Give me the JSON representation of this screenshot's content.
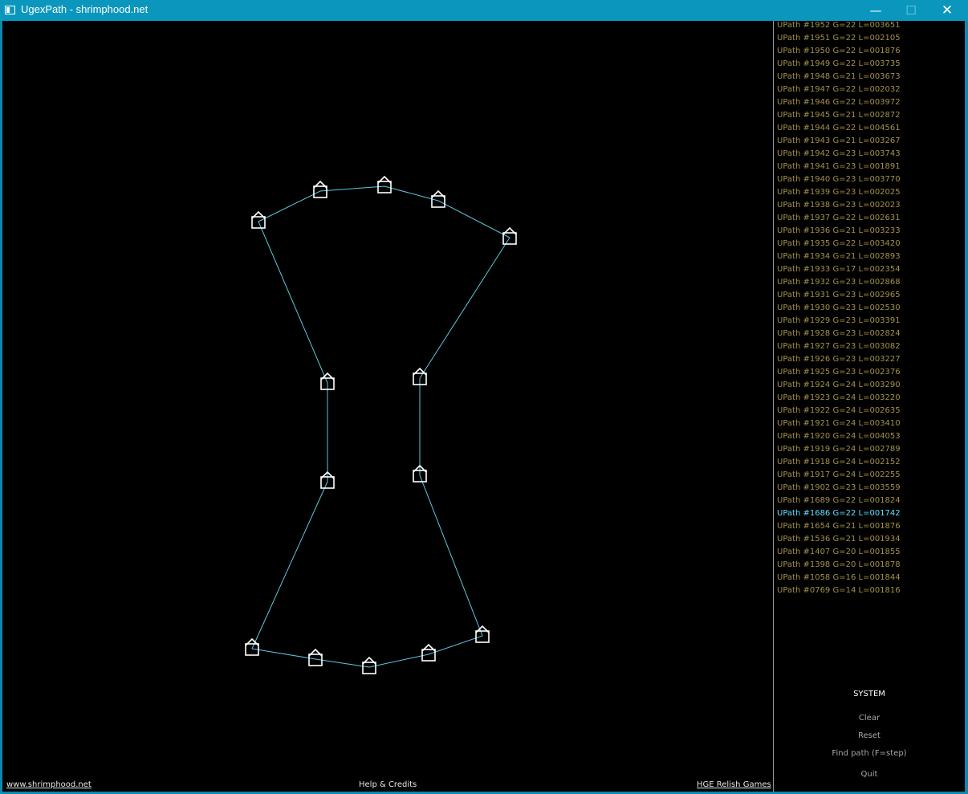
{
  "window": {
    "title": "UgexPath - shrimphood.net",
    "minimize": "—",
    "maximize": "☐",
    "close": "✕"
  },
  "path_list": [
    "UPath #1952 G=22 L=003651",
    "UPath #1951 G=22 L=002105",
    "UPath #1950 G=22 L=001876",
    "UPath #1949 G=22 L=003735",
    "UPath #1948 G=21 L=003673",
    "UPath #1947 G=22 L=002032",
    "UPath #1946 G=22 L=003972",
    "UPath #1945 G=21 L=002872",
    "UPath #1944 G=22 L=004561",
    "UPath #1943 G=21 L=003267",
    "UPath #1942 G=23 L=003743",
    "UPath #1941 G=23 L=001891",
    "UPath #1940 G=23 L=003770",
    "UPath #1939 G=23 L=002025",
    "UPath #1938 G=23 L=002023",
    "UPath #1937 G=22 L=002631",
    "UPath #1936 G=21 L=003233",
    "UPath #1935 G=22 L=003420",
    "UPath #1934 G=21 L=002893",
    "UPath #1933 G=17 L=002354",
    "UPath #1932 G=23 L=002868",
    "UPath #1931 G=23 L=002965",
    "UPath #1930 G=23 L=002530",
    "UPath #1929 G=23 L=003391",
    "UPath #1928 G=23 L=002824",
    "UPath #1927 G=23 L=003082",
    "UPath #1926 G=23 L=003227",
    "UPath #1925 G=23 L=002376",
    "UPath #1924 G=24 L=003290",
    "UPath #1923 G=24 L=003220",
    "UPath #1922 G=24 L=002635",
    "UPath #1921 G=24 L=003410",
    "UPath #1920 G=24 L=004053",
    "UPath #1919 G=24 L=002789",
    "UPath #1918 G=24 L=002152",
    "UPath #1917 G=24 L=002255",
    "UPath #1902 G=23 L=003559",
    "UPath #1689 G=22 L=001824",
    "UPath #1686 G=22 L=001742",
    "UPath #1654 G=21 L=001876",
    "UPath #1536 G=21 L=001934",
    "UPath #1407 G=20 L=001855",
    "UPath #1398 G=20 L=001878",
    "UPath #1058 G=16 L=001844",
    "UPath #0769 G=14 L=001816"
  ],
  "selected_path_index": 38,
  "menu": {
    "title": "SYSTEM",
    "clear": "Clear",
    "reset": "Reset",
    "find_path": "Find path (F=step)",
    "quit": "Quit"
  },
  "footer": {
    "left_link": "www.shrimphood.net",
    "center": "Help & Credits",
    "right_link": "HGE Relish Games"
  },
  "colors": {
    "path_line": "#5ec8df",
    "node": "#ffffff",
    "list_text": "#a2914a",
    "list_selected": "#5fe0ff"
  }
}
